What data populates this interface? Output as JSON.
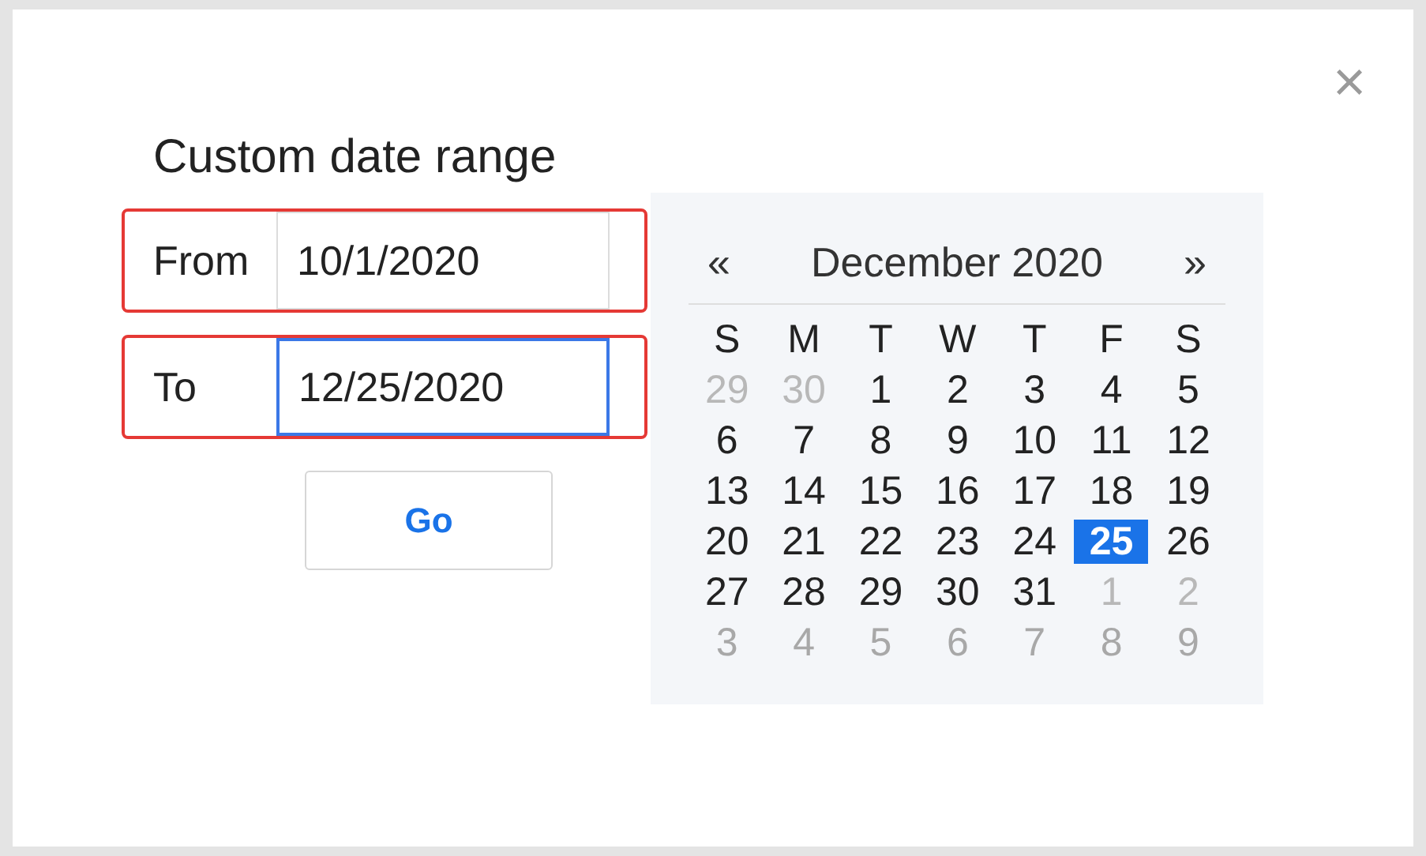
{
  "dialog": {
    "title": "Custom date range",
    "close": "×"
  },
  "fields": [
    {
      "label": "From",
      "value": "10/1/2020",
      "focused": false,
      "highlighted": true
    },
    {
      "label": "To",
      "value": "12/25/2020",
      "focused": true,
      "highlighted": true
    }
  ],
  "go_button": "Go",
  "calendar": {
    "prev": "«",
    "month": "December 2020",
    "next": "»",
    "weekdays": [
      "S",
      "M",
      "T",
      "W",
      "T",
      "F",
      "S"
    ],
    "weeks": [
      {
        "days": [
          {
            "day": "29",
            "outside": true,
            "selected": false
          },
          {
            "day": "30",
            "outside": true,
            "selected": false
          },
          {
            "day": "1",
            "outside": false,
            "selected": false
          },
          {
            "day": "2",
            "outside": false,
            "selected": false
          },
          {
            "day": "3",
            "outside": false,
            "selected": false
          },
          {
            "day": "4",
            "outside": false,
            "selected": false
          },
          {
            "day": "5",
            "outside": false,
            "selected": false
          }
        ]
      },
      {
        "days": [
          {
            "day": "6",
            "outside": false,
            "selected": false
          },
          {
            "day": "7",
            "outside": false,
            "selected": false
          },
          {
            "day": "8",
            "outside": false,
            "selected": false
          },
          {
            "day": "9",
            "outside": false,
            "selected": false
          },
          {
            "day": "10",
            "outside": false,
            "selected": false
          },
          {
            "day": "11",
            "outside": false,
            "selected": false
          },
          {
            "day": "12",
            "outside": false,
            "selected": false
          }
        ]
      },
      {
        "days": [
          {
            "day": "13",
            "outside": false,
            "selected": false
          },
          {
            "day": "14",
            "outside": false,
            "selected": false
          },
          {
            "day": "15",
            "outside": false,
            "selected": false
          },
          {
            "day": "16",
            "outside": false,
            "selected": false
          },
          {
            "day": "17",
            "outside": false,
            "selected": false
          },
          {
            "day": "18",
            "outside": false,
            "selected": false
          },
          {
            "day": "19",
            "outside": false,
            "selected": false
          }
        ]
      },
      {
        "days": [
          {
            "day": "20",
            "outside": false,
            "selected": false
          },
          {
            "day": "21",
            "outside": false,
            "selected": false
          },
          {
            "day": "22",
            "outside": false,
            "selected": false
          },
          {
            "day": "23",
            "outside": false,
            "selected": false
          },
          {
            "day": "24",
            "outside": false,
            "selected": false
          },
          {
            "day": "25",
            "outside": false,
            "selected": true
          },
          {
            "day": "26",
            "outside": false,
            "selected": false
          }
        ]
      },
      {
        "days": [
          {
            "day": "27",
            "outside": false,
            "selected": false
          },
          {
            "day": "28",
            "outside": false,
            "selected": false
          },
          {
            "day": "29",
            "outside": false,
            "selected": false
          },
          {
            "day": "30",
            "outside": false,
            "selected": false
          },
          {
            "day": "31",
            "outside": false,
            "selected": false
          },
          {
            "day": "1",
            "outside": true,
            "selected": false
          },
          {
            "day": "2",
            "outside": true,
            "selected": false
          }
        ]
      },
      {
        "days": [
          {
            "day": "3",
            "outside": true,
            "selected": false
          },
          {
            "day": "4",
            "outside": true,
            "selected": false
          },
          {
            "day": "5",
            "outside": true,
            "selected": false
          },
          {
            "day": "6",
            "outside": true,
            "selected": false
          },
          {
            "day": "7",
            "outside": true,
            "selected": false
          },
          {
            "day": "8",
            "outside": true,
            "selected": false
          },
          {
            "day": "9",
            "outside": true,
            "selected": false
          }
        ]
      }
    ]
  }
}
